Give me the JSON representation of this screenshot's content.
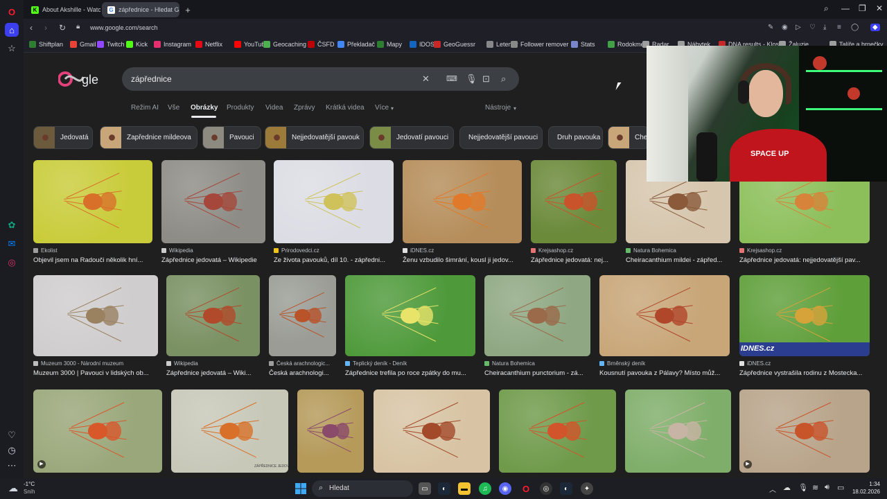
{
  "browser": {
    "tabs": [
      {
        "title": "About Akshille - Watch Li",
        "favicon_color": "#53fc18"
      },
      {
        "title": "zápřednice - Hledat Goog",
        "favicon_color": "#4285f4"
      }
    ],
    "url": "www.google.com/search",
    "bookmarks": [
      {
        "label": "Shiftplan",
        "color": "#2e7d32"
      },
      {
        "label": "Gmail",
        "color": "#ea4335"
      },
      {
        "label": "Twitch",
        "color": "#9146ff"
      },
      {
        "label": "Kick",
        "color": "#53fc18"
      },
      {
        "label": "Instagram",
        "color": "#e1306c"
      },
      {
        "label": "Netflix",
        "color": "#e50914"
      },
      {
        "label": "YouTube",
        "color": "#ff0000"
      },
      {
        "label": "Geocaching",
        "color": "#4caf50"
      },
      {
        "label": "ČSFD",
        "color": "#ba0305"
      },
      {
        "label": "Překladač",
        "color": "#4285f4"
      },
      {
        "label": "Mapy",
        "color": "#2e7d32"
      },
      {
        "label": "IDOS",
        "color": "#1565c0"
      },
      {
        "label": "GeoGuessr",
        "color": "#c62828"
      },
      {
        "label": "Letenky",
        "color": "#888888"
      },
      {
        "label": "Follower remover",
        "color": "#888888"
      },
      {
        "label": "Stats",
        "color": "#7986cb"
      },
      {
        "label": "Rodokmen",
        "color": "#43a047"
      },
      {
        "label": "Radar",
        "color": "#9e9e9e"
      },
      {
        "label": "Nábytek",
        "color": "#9e9e9e"
      },
      {
        "label": "DNA results - Klose",
        "color": "#c62828"
      },
      {
        "label": "Žaluzie",
        "color": "#9e9e9e"
      },
      {
        "label": "Talíře a hrnečky",
        "color": "#9e9e9e"
      }
    ]
  },
  "search": {
    "query": "zápřednice",
    "tabs": [
      "Režim AI",
      "Vše",
      "Obrázky",
      "Produkty",
      "Videa",
      "Zprávy",
      "Krátká videa",
      "Více"
    ],
    "active_tab": "Obrázky",
    "tools_label": "Nástroje"
  },
  "chips": [
    {
      "label": "Jedovatá",
      "color": "#6b5a3c"
    },
    {
      "label": "Zapřednice mildeova",
      "color": "#c9a67a"
    },
    {
      "label": "Pavouci",
      "color": "#8d8a80"
    },
    {
      "label": "Nejjedovatější pavouk",
      "color": "#9b7a3a"
    },
    {
      "label": "Jedovatí pavouci",
      "color": "#7a8c45"
    },
    {
      "label": "Nejjedovatější pavouci",
      "color": ""
    },
    {
      "label": "Druh pavouka",
      "color": ""
    },
    {
      "label": "Che",
      "color": "#c9a67a"
    }
  ],
  "results": [
    {
      "source": "Ekolist",
      "title": "Objevil jsem na Radouči několik hní...",
      "bg": "#c9cc3a",
      "spider": "#d8702a",
      "fav": "#9e9e9e"
    },
    {
      "source": "Wikipedia",
      "title": "Zápřednice jedovatá – Wikipedie",
      "bg": "#8d8c86",
      "spider": "#a5473a",
      "fav": "#cccccc"
    },
    {
      "source": "Prirodovedci.cz",
      "title": "Ze života pavouků, díl 10. - zápředni...",
      "bg": "#dcdde4",
      "spider": "#cfc25a",
      "fav": "#f0c419"
    },
    {
      "source": "iDNES.cz",
      "title": "Ženu vzbudilo šimrání, kousl ji jedov...",
      "bg": "#b58d5a",
      "spider": "#e07a2a",
      "fav": "#e0e0e0"
    },
    {
      "source": "Krejsashop.cz",
      "title": "Zápřednice jedovatá: nej...",
      "bg": "#6b8a3a",
      "spider": "#c9532a",
      "fav": "#e57373"
    },
    {
      "source": "Natura Bohemica",
      "title": "Cheiracanthium mildei - zápřed...",
      "bg": "#d6c6ad",
      "spider": "#8a5a3a",
      "fav": "#66bb6a"
    },
    {
      "source": "Krejsashop.cz",
      "title": "Zápřednice jedovatá: nejjedovatější pav...",
      "bg": "#8cbf5a",
      "spider": "#d7833a",
      "fav": "#e57373"
    },
    {
      "source": "Muzeum 3000 - Národní muzeum",
      "title": "Muzeum 3000 | Pavouci v lidských ob...",
      "bg": "#cfcdcd",
      "spider": "#9a8160",
      "fav": "#bdbdbd"
    },
    {
      "source": "Wikipedia",
      "title": "Zápřednice jedovatá – Wiki...",
      "bg": "#7a9163",
      "spider": "#b04a2a",
      "fav": "#cccccc"
    },
    {
      "source": "Česká arachnologic...",
      "title": "Česká arachnologi...",
      "bg": "#9a9c95",
      "spider": "#b8532a",
      "fav": "#9e9e9e"
    },
    {
      "source": "Teplický deník - Deník",
      "title": "Zápřednice trefila po roce zpátky do mu...",
      "bg": "#4e9a3a",
      "spider": "#e8e46a",
      "fav": "#64b5f6"
    },
    {
      "source": "Natura Bohemica",
      "title": "Cheiracanthium punctorium - zá...",
      "bg": "#8fa883",
      "spider": "#9a6a4a",
      "fav": "#66bb6a"
    },
    {
      "source": "Brněnský deník",
      "title": "Kousnutí pavouka z Pálavy? Místo můž...",
      "bg": "#c8a678",
      "spider": "#b0462a",
      "fav": "#64b5f6"
    },
    {
      "source": "iDNES.cz",
      "title": "Zápřednice vystrašila rodinu z Mostecka...",
      "bg": "#5f9f3a",
      "spider": "#d6a23a",
      "fav": "#e0e0e0"
    },
    {
      "bg": "#9aa77a",
      "spider": "#d8582a"
    },
    {
      "bg": "#c7c8b8",
      "spider": "#d8702a"
    },
    {
      "bg": "#b59a5a",
      "spider": "#8a4a6a"
    },
    {
      "bg": "#d8c4a4",
      "spider": "#a24a2a"
    },
    {
      "bg": "#6f9a4a",
      "spider": "#d2542a"
    },
    {
      "bg": "#7fae6a",
      "spider": "#c8b4a4"
    },
    {
      "bg": "#b8a48a",
      "spider": "#c8542a"
    }
  ],
  "row3_caption": "ZÁPŘEDNICE JEDOVATÁ",
  "overlay_text": "IDNES.cz",
  "webcam": {
    "shirt_text": "SPACE UP"
  },
  "taskbar": {
    "weather_temp": "-1°C",
    "weather_desc": "Sníh",
    "search_placeholder": "Hledat",
    "time": "1:34",
    "date": "18.02.2026"
  }
}
